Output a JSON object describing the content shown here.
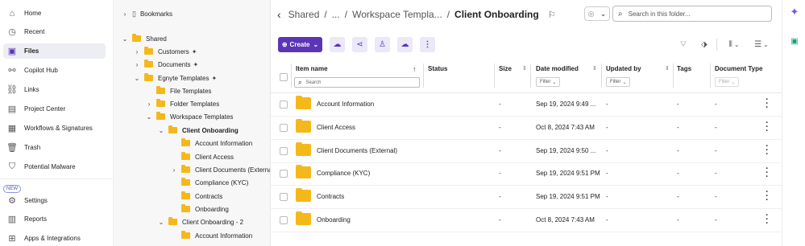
{
  "nav": {
    "items": [
      {
        "label": "Home",
        "icon": "home-icon",
        "glyph": "⌂"
      },
      {
        "label": "Recent",
        "icon": "clock-icon",
        "glyph": "◷"
      },
      {
        "label": "Files",
        "icon": "files-icon",
        "glyph": "▣"
      },
      {
        "label": "Copilot Hub",
        "icon": "copilot-icon",
        "glyph": "⚯"
      },
      {
        "label": "Links",
        "icon": "link-icon",
        "glyph": "⛓"
      },
      {
        "label": "Project Center",
        "icon": "briefcase-icon",
        "glyph": "▤"
      },
      {
        "label": "Workflows & Signatures",
        "icon": "workflow-icon",
        "glyph": "▦"
      },
      {
        "label": "Trash",
        "icon": "trash-icon",
        "glyph": "🗑"
      },
      {
        "label": "Potential Malware",
        "icon": "shield-icon",
        "glyph": "⛉"
      },
      {
        "label": "Settings",
        "icon": "gear-icon",
        "glyph": "⚙"
      },
      {
        "label": "Reports",
        "icon": "report-icon",
        "glyph": "▥"
      },
      {
        "label": "Apps & Integrations",
        "icon": "apps-icon",
        "glyph": "⊞"
      }
    ],
    "new_badge": "NEW"
  },
  "tree": {
    "rows": [
      {
        "label": "Bookmarks",
        "chev": "›",
        "icon": "bookmark"
      },
      {
        "label": "Shared",
        "chev": "⌄"
      },
      {
        "label": "Customers",
        "chev": "›",
        "spark": true
      },
      {
        "label": "Documents",
        "chev": "›",
        "spark": true
      },
      {
        "label": "Egnyte Templates",
        "chev": "⌄",
        "spark": true
      },
      {
        "label": "File Templates",
        "chev": ""
      },
      {
        "label": "Folder Templates",
        "chev": "›"
      },
      {
        "label": "Workspace Templates",
        "chev": "⌄"
      },
      {
        "label": "Client Onboarding",
        "chev": "⌄",
        "bold": true
      },
      {
        "label": "Account Information",
        "chev": ""
      },
      {
        "label": "Client Access",
        "chev": ""
      },
      {
        "label": "Client Documents (Externa",
        "chev": "›"
      },
      {
        "label": "Compliance (KYC)",
        "chev": ""
      },
      {
        "label": "Contracts",
        "chev": ""
      },
      {
        "label": "Onboarding",
        "chev": ""
      },
      {
        "label": "Client Onboarding - 2",
        "chev": "⌄"
      },
      {
        "label": "Account Information",
        "chev": ""
      }
    ]
  },
  "breadcrumb": {
    "back": "‹",
    "items": [
      "Shared",
      "/",
      "...",
      "/",
      "Workspace Templa...",
      "/"
    ],
    "current": "Client Onboarding"
  },
  "search": {
    "placeholder": "Search in this folder..."
  },
  "toolbar": {
    "create_label": "Create"
  },
  "table": {
    "headers": {
      "name": "Item name",
      "status": "Status",
      "size": "Size",
      "date": "Date modified",
      "updated": "Updated by",
      "tags": "Tags",
      "doctype": "Document Type"
    },
    "name_search_placeholder": "Search",
    "filter_label": "Filter",
    "rows": [
      {
        "name": "Account Information",
        "status": "",
        "size": "-",
        "date": "Sep 19, 2024 9:49 ...",
        "updated": "-",
        "tags": "-",
        "doctype": "-"
      },
      {
        "name": "Client Access",
        "status": "",
        "size": "-",
        "date": "Oct 8, 2024 7:43 AM",
        "updated": "-",
        "tags": "-",
        "doctype": "-"
      },
      {
        "name": "Client Documents (External)",
        "status": "",
        "size": "-",
        "date": "Sep 19, 2024 9:50 ...",
        "updated": "-",
        "tags": "-",
        "doctype": "-"
      },
      {
        "name": "Compliance (KYC)",
        "status": "",
        "size": "-",
        "date": "Sep 19, 2024 9:51 PM",
        "updated": "-",
        "tags": "-",
        "doctype": "-"
      },
      {
        "name": "Contracts",
        "status": "",
        "size": "-",
        "date": "Sep 19, 2024 9:51 PM",
        "updated": "-",
        "tags": "-",
        "doctype": "-"
      },
      {
        "name": "Onboarding",
        "status": "",
        "size": "-",
        "date": "Oct 8, 2024 7:43 AM",
        "updated": "-",
        "tags": "-",
        "doctype": "-"
      }
    ]
  },
  "colors": {
    "accent": "#5b35b5",
    "folder": "#f5b81b"
  }
}
